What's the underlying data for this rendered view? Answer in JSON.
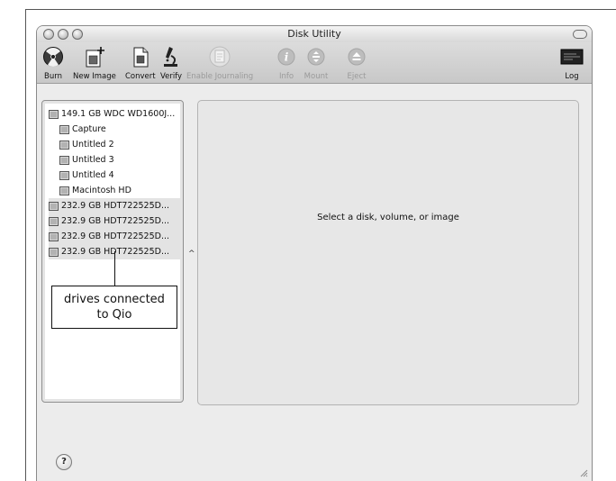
{
  "window": {
    "title": "Disk Utility"
  },
  "toolbar": {
    "burn": "Burn",
    "new_image": "New Image",
    "convert": "Convert",
    "verify": "Verify",
    "enable_journaling": "Enable Journaling",
    "info": "Info",
    "mount": "Mount",
    "eject": "Eject",
    "log": "Log"
  },
  "disk_list": [
    {
      "label": "149.1 GB WDC WD1600J...",
      "kind": "disk"
    },
    {
      "label": "Capture",
      "kind": "volume"
    },
    {
      "label": "Untitled 2",
      "kind": "volume"
    },
    {
      "label": "Untitled 3",
      "kind": "volume"
    },
    {
      "label": "Untitled 4",
      "kind": "volume"
    },
    {
      "label": "Macintosh HD",
      "kind": "volume"
    },
    {
      "label": "232.9 GB HDT722525D...",
      "kind": "disk"
    },
    {
      "label": "232.9 GB HDT722525D...",
      "kind": "disk"
    },
    {
      "label": "232.9 GB HDT722525D...",
      "kind": "disk"
    },
    {
      "label": "232.9 GB HDT722525D...",
      "kind": "disk"
    }
  ],
  "main": {
    "message": "Select a disk, volume, or image"
  },
  "callout": {
    "line1": "drives connected",
    "line2": "to Qio"
  },
  "help": {
    "symbol": "?"
  }
}
